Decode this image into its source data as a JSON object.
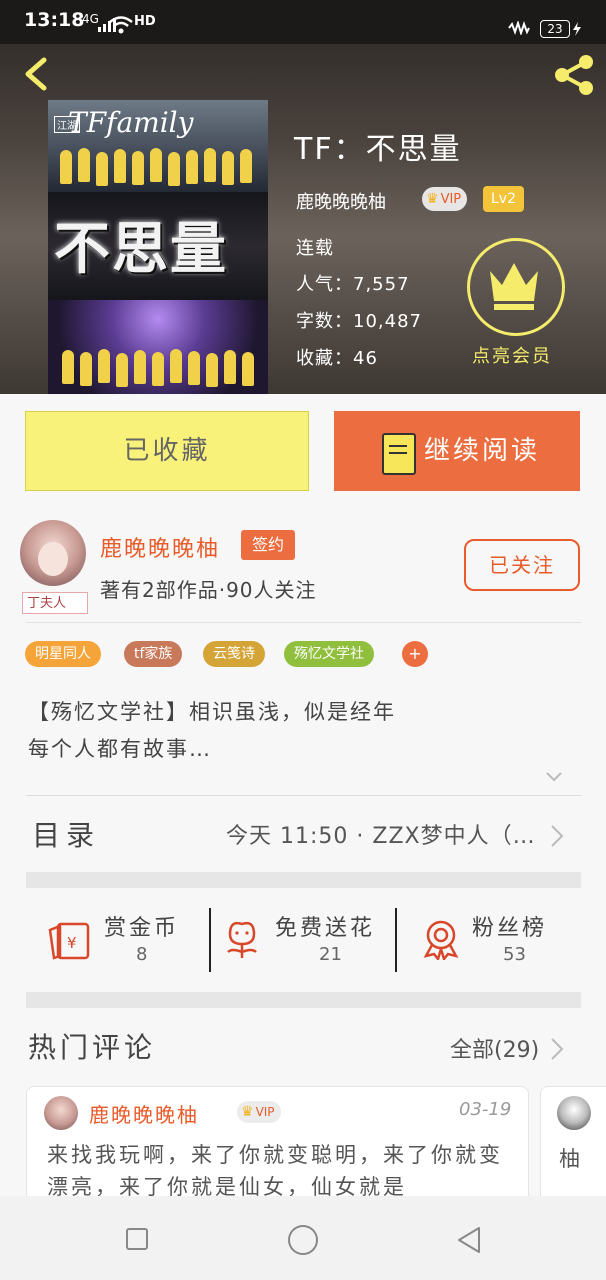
{
  "status_bar": {
    "time": "13:18",
    "signal": "4G",
    "hd": "HD",
    "battery": "23"
  },
  "book": {
    "title": "TF：不思量",
    "cover_title": "不思量",
    "cover_logo": "TFfamily",
    "cover_badge": "江湖",
    "author": "鹿晚晚晚柚",
    "vip": "VIP",
    "level": "Lv2",
    "status": "连载",
    "popularity": "人气：7,557",
    "words": "字数：10,487",
    "favorites": "收藏：46",
    "member_label": "点亮会员"
  },
  "actions": {
    "favorited": "已收藏",
    "continue_reading": "继续阅读"
  },
  "author_card": {
    "name": "鹿晚晚晚柚",
    "avatar_tag": "丁夫人",
    "signed_badge": "签约",
    "summary": "著有2部作品·90人关注",
    "follow_label": "已关注"
  },
  "tags": [
    {
      "label": "明星同人",
      "color": "#f5a43a"
    },
    {
      "label": "tf家族",
      "color": "#c8795a"
    },
    {
      "label": "云笺诗",
      "color": "#d4a437"
    },
    {
      "label": "殇忆文学社",
      "color": "#8fbf3c"
    }
  ],
  "tag_more": "+",
  "description": [
    "【殇忆文学社】相识虽浅，似是经年",
    "每个人都有故事…"
  ],
  "catalog": {
    "label": "目录",
    "latest": "今天 11:50 · ZZX梦中人（…"
  },
  "stats": [
    {
      "label": "赏金币",
      "value": "8",
      "icon": "red-envelope-icon"
    },
    {
      "label": "免费送花",
      "value": "21",
      "icon": "flower-icon"
    },
    {
      "label": "粉丝榜",
      "value": "53",
      "icon": "medal-icon"
    }
  ],
  "hot_comments": {
    "title": "热门评论",
    "all_label": "全部(29)",
    "items": [
      {
        "name": "鹿晚晚晚柚",
        "vip": "VIP",
        "date": "03-19",
        "text": "来找我玩啊，来了你就变聪明，来了你就变漂亮，来了你就是仙女，仙女就是"
      },
      {
        "name_partial": "柚"
      }
    ]
  },
  "colors": {
    "accent": "#ec6d3f",
    "favorite_button": "#f9f27a",
    "member_gold": "#f6ec6c"
  }
}
